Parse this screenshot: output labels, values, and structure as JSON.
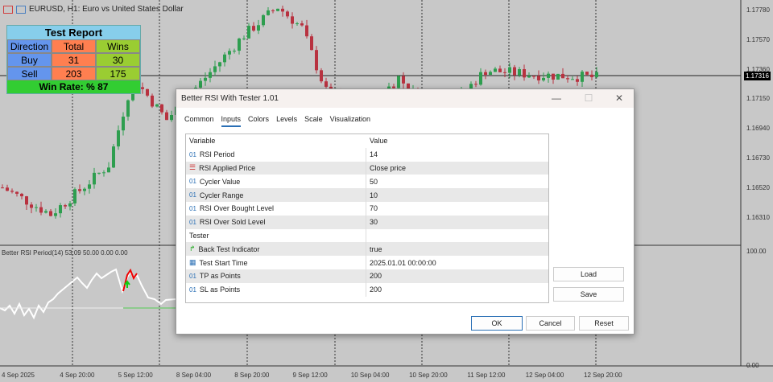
{
  "symbol": {
    "title": "EURUSD, H1:  Euro vs United States Dollar"
  },
  "indicator_label": "Better RSI Period(14) 53.09 50.00 0.00 0.00",
  "price_axis": [
    "1.17780",
    "1.17570",
    "1.17360",
    "1.17150",
    "1.16940",
    "1.16730",
    "1.16520",
    "1.16310"
  ],
  "current_price": "1.17316",
  "ind_axis": [
    "100.00",
    "0.00"
  ],
  "time_axis": [
    "4 Sep 2025",
    "4 Sep 20:00",
    "5 Sep 12:00",
    "8 Sep 04:00",
    "8 Sep 20:00",
    "9 Sep 12:00",
    "10 Sep 04:00",
    "10 Sep 20:00",
    "11 Sep 12:00",
    "12 Sep 04:00",
    "12 Sep 20:00"
  ],
  "price_path": [
    [
      0,
      1.1652
    ],
    [
      10,
      1.1633
    ],
    [
      16,
      1.165
    ],
    [
      22,
      1.1668
    ],
    [
      27,
      1.173
    ],
    [
      34,
      1.17
    ],
    [
      42,
      1.173
    ],
    [
      50,
      1.176
    ],
    [
      57,
      1.178
    ],
    [
      62,
      1.1765
    ],
    [
      67,
      1.172
    ],
    [
      75,
      1.1705
    ],
    [
      82,
      1.173
    ],
    [
      90,
      1.17
    ],
    [
      100,
      1.1735
    ],
    [
      110,
      1.1732
    ],
    [
      123,
      1.173
    ]
  ],
  "report": {
    "title": "Test Report",
    "headers": [
      "Direction",
      "Total",
      "Wins"
    ],
    "rows": [
      [
        "Buy",
        "31",
        "30"
      ],
      [
        "Sell",
        "203",
        "175"
      ]
    ],
    "win_rate": "Win Rate: %  87"
  },
  "dialog": {
    "title": "Better RSI With Tester 1.01",
    "tabs": [
      "Common",
      "Inputs",
      "Colors",
      "Levels",
      "Scale",
      "Visualization"
    ],
    "columns": [
      "Variable",
      "Value"
    ],
    "rows": [
      {
        "icon": "01",
        "name": "RSI Period",
        "value": "14"
      },
      {
        "icon": "enum",
        "name": "RSI Applied Price",
        "value": "Close price"
      },
      {
        "icon": "01",
        "name": "Cycler Value",
        "value": "50"
      },
      {
        "icon": "01",
        "name": "Cycler Range",
        "value": "10"
      },
      {
        "icon": "01",
        "name": "RSI Over Bought Level",
        "value": "70"
      },
      {
        "icon": "01",
        "name": "RSI Over Sold Level",
        "value": "30"
      },
      {
        "icon": "",
        "name": "Tester",
        "value": ""
      },
      {
        "icon": "bool",
        "name": "Back Test Indicator",
        "value": "true"
      },
      {
        "icon": "date",
        "name": "Test Start Time",
        "value": "2025.01.01 00:00:00"
      },
      {
        "icon": "01",
        "name": "TP as Points",
        "value": "200"
      },
      {
        "icon": "01",
        "name": "SL as Points",
        "value": "200"
      }
    ],
    "load": "Load",
    "save": "Save",
    "ok": "OK",
    "cancel": "Cancel",
    "reset": "Reset"
  }
}
